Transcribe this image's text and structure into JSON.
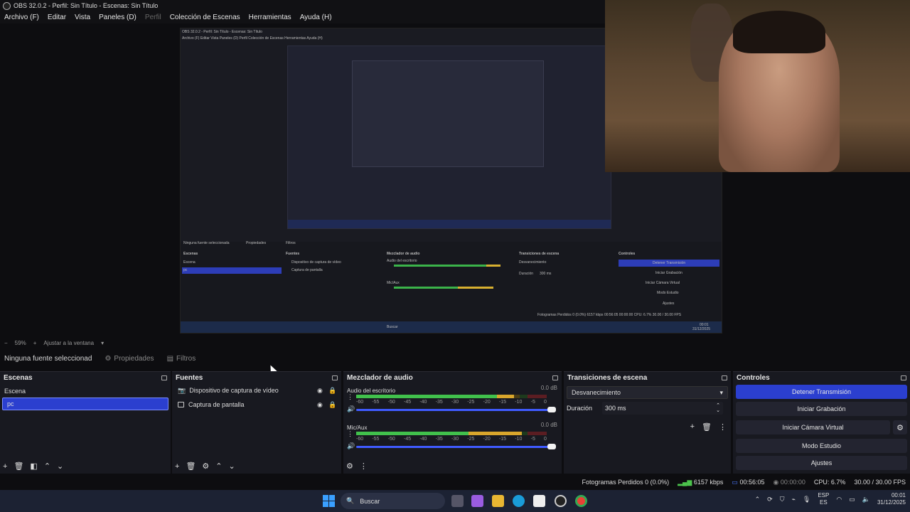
{
  "window": {
    "title": "OBS 32.0.2 - Perfil: Sin Título - Escenas: Sin Título"
  },
  "menu": [
    {
      "label": "Archivo (F)",
      "enabled": true
    },
    {
      "label": "Editar",
      "enabled": true
    },
    {
      "label": "Vista",
      "enabled": true
    },
    {
      "label": "Paneles (D)",
      "enabled": true
    },
    {
      "label": "Perfil",
      "enabled": false
    },
    {
      "label": "Colección de Escenas",
      "enabled": true
    },
    {
      "label": "Herramientas",
      "enabled": true
    },
    {
      "label": "Ayuda (H)",
      "enabled": true
    }
  ],
  "preview": {
    "zoom": "59%",
    "fit_label": "Ajustar a la ventana",
    "nested_title": "OBS 32.0.2 - Perfil: Sin Título - Escenas: Sin Título",
    "nested_menu": "Archivo (F)   Editar   Vista   Paneles (D)   Perfil   Colección de Escenas   Herramientas   Ayuda (H)",
    "nested_labels": {
      "no_source": "Ninguna fuente seleccionada",
      "properties": "Propiedades",
      "filters": "Filtros",
      "scenes": "Escenas",
      "sources": "Fuentes",
      "mixer": "Mezclador de audio",
      "transitions": "Transiciones de escena",
      "controls": "Controles",
      "scene1": "Escena",
      "scene2": "pc",
      "src1": "Dispositivo de captura de vídeo",
      "src2": "Captura de pantalla",
      "desk_audio": "Audio del escritorio",
      "mic": "Mic/Aux",
      "fade": "Desvanecimiento",
      "duration": "Duración",
      "duration_val": "300 ms",
      "stop_stream": "Detener Transmisión",
      "start_rec": "Iniciar Grabación",
      "virtual_cam": "Iniciar Cámara Virtual",
      "studio": "Modo Estudio",
      "settings": "Ajustes",
      "status": "Fotogramas Perdidos 0 (0.0%)   6157 kbps   00:56:05   00:00:00   CPU: 6.7%   30.00 / 30.00 FPS",
      "search": "Buscar",
      "tray_time": "00:01",
      "tray_date": "31/12/2025"
    }
  },
  "source_toolbar": {
    "no_source": "Ninguna fuente seleccionad",
    "properties": "Propiedades",
    "filters": "Filtros"
  },
  "scenes": {
    "title": "Escenas",
    "items": [
      {
        "label": "Escena",
        "selected": false
      },
      {
        "label": "pc",
        "selected": true
      }
    ]
  },
  "sources": {
    "title": "Fuentes",
    "items": [
      {
        "label": "Dispositivo de captura de vídeo",
        "icon": "camera-icon"
      },
      {
        "label": "Captura de pantalla",
        "icon": "monitor-icon"
      }
    ]
  },
  "mixer": {
    "title": "Mezclador de audio",
    "channels": [
      {
        "name": "Audio del escritorio",
        "db": "0.0 dB",
        "level_green": 0.74,
        "level_yellow": 0.09
      },
      {
        "name": "Mic/Aux",
        "db": "0.0 dB",
        "level_green": 0.59,
        "level_yellow": 0.28
      }
    ],
    "ticks": [
      "-60",
      "-55",
      "-50",
      "-45",
      "-40",
      "-35",
      "-30",
      "-25",
      "-20",
      "-15",
      "-10",
      "-5",
      "0"
    ]
  },
  "transitions": {
    "title": "Transiciones de escena",
    "selected": "Desvanecimiento",
    "duration_label": "Duración",
    "duration_value": "300 ms"
  },
  "controls": {
    "title": "Controles",
    "stop_stream": "Detener Transmisión",
    "start_recording": "Iniciar Grabación",
    "start_virtual_cam": "Iniciar Cámara Virtual",
    "studio_mode": "Modo Estudio",
    "settings": "Ajustes"
  },
  "status": {
    "dropped_frames": "Fotogramas Perdidos 0 (0.0%)",
    "bitrate": "6157 kbps",
    "stream_time": "00:56:05",
    "rec_time": "00:00:00",
    "cpu": "CPU: 6.7%",
    "fps": "30.00 / 30.00 FPS"
  },
  "taskbar": {
    "search": "Buscar",
    "lang_line1": "ESP",
    "lang_line2": "ES",
    "time": "00:01",
    "date": "31/12/2025"
  },
  "colors": {
    "accent_blue": "#2b3fcf",
    "meter_green": "#41c14c",
    "meter_yellow": "#d9a62c",
    "taskbar": "#1c2233"
  }
}
